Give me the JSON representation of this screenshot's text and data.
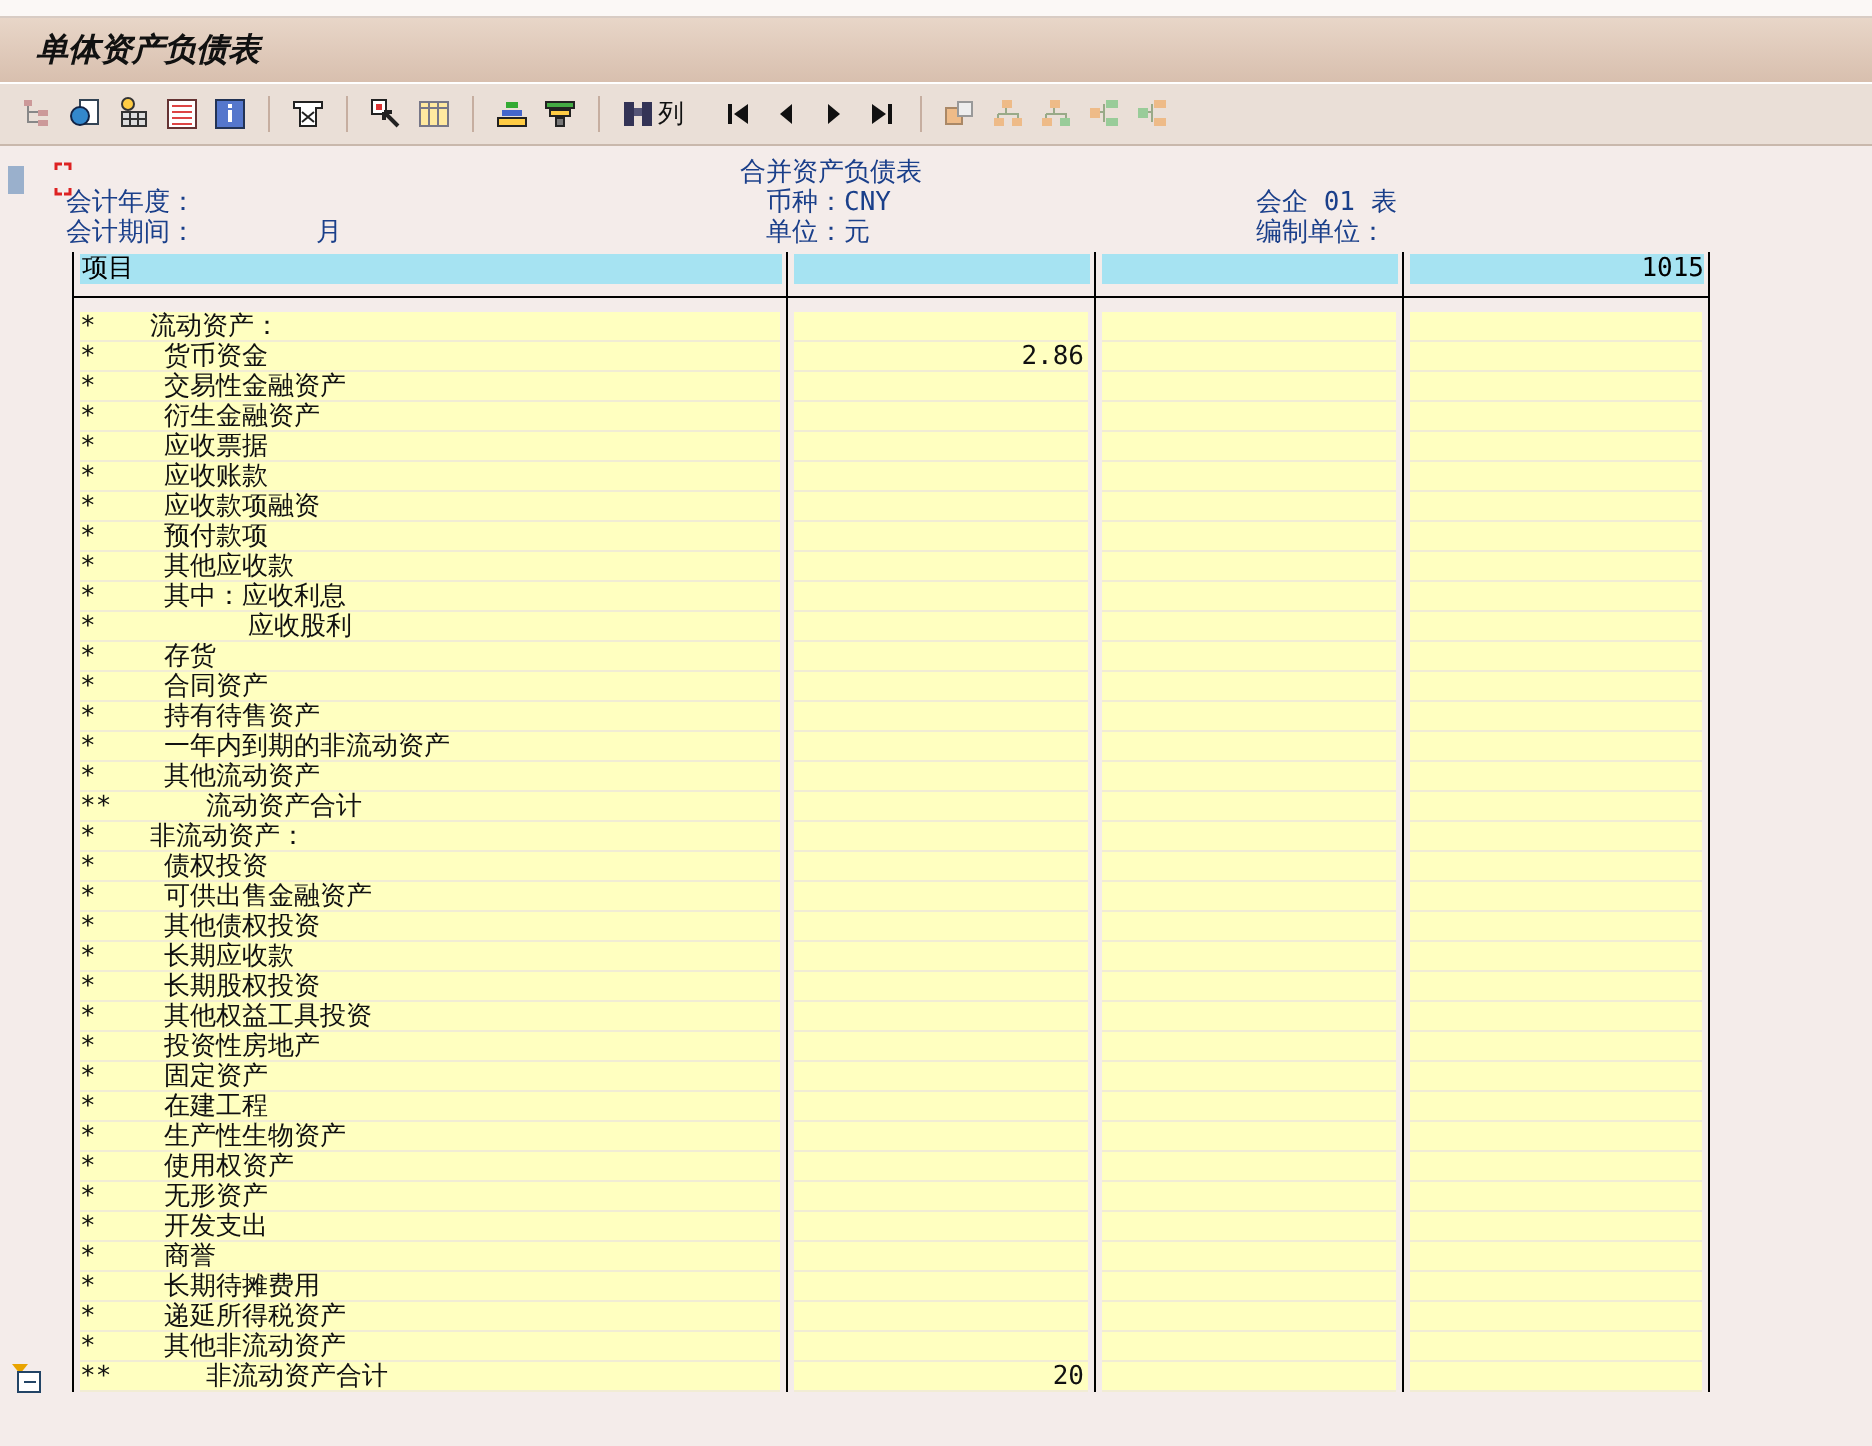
{
  "window": {
    "title": "单体资产负债表"
  },
  "toolbar": {
    "find_label": "列"
  },
  "report": {
    "title": "合并资产负债表",
    "currency": "币种：CNY",
    "unit": "单位：元",
    "form_no": "会企 01 表",
    "company_label": "编制单位：",
    "year_label": "会计年度：",
    "period_label": "会计期间：",
    "period_month": "月"
  },
  "table": {
    "columns": [
      "项目",
      "",
      "",
      "1015"
    ],
    "rows": [
      {
        "marker": "*",
        "label": "流动资产：",
        "kind": "heading"
      },
      {
        "marker": "*",
        "label": "货币资金",
        "kind": "item",
        "value": "2.86"
      },
      {
        "marker": "*",
        "label": "交易性金融资产",
        "kind": "item"
      },
      {
        "marker": "*",
        "label": "衍生金融资产",
        "kind": "item"
      },
      {
        "marker": "*",
        "label": "应收票据",
        "kind": "item"
      },
      {
        "marker": "*",
        "label": "应收账款",
        "kind": "item"
      },
      {
        "marker": "*",
        "label": "应收款项融资",
        "kind": "item"
      },
      {
        "marker": "*",
        "label": "预付款项",
        "kind": "item"
      },
      {
        "marker": "*",
        "label": "其他应收款",
        "kind": "item"
      },
      {
        "marker": "*",
        "label": "其中：应收利息",
        "kind": "item"
      },
      {
        "marker": "*",
        "label": "应收股利",
        "kind": "sub"
      },
      {
        "marker": "*",
        "label": "存货",
        "kind": "item"
      },
      {
        "marker": "*",
        "label": "合同资产",
        "kind": "item"
      },
      {
        "marker": "*",
        "label": "持有待售资产",
        "kind": "item"
      },
      {
        "marker": "*",
        "label": "一年内到期的非流动资产",
        "kind": "item"
      },
      {
        "marker": "*",
        "label": "其他流动资产",
        "kind": "item"
      },
      {
        "marker": "**",
        "label": "流动资产合计",
        "kind": "subtotal"
      },
      {
        "marker": "*",
        "label": "非流动资产：",
        "kind": "heading"
      },
      {
        "marker": "*",
        "label": "债权投资",
        "kind": "item"
      },
      {
        "marker": "*",
        "label": "可供出售金融资产",
        "kind": "item"
      },
      {
        "marker": "*",
        "label": "其他债权投资",
        "kind": "item"
      },
      {
        "marker": "*",
        "label": "长期应收款",
        "kind": "item"
      },
      {
        "marker": "*",
        "label": "长期股权投资",
        "kind": "item"
      },
      {
        "marker": "*",
        "label": "其他权益工具投资",
        "kind": "item"
      },
      {
        "marker": "*",
        "label": "投资性房地产",
        "kind": "item"
      },
      {
        "marker": "*",
        "label": "固定资产",
        "kind": "item"
      },
      {
        "marker": "*",
        "label": "在建工程",
        "kind": "item"
      },
      {
        "marker": "*",
        "label": "生产性生物资产",
        "kind": "item"
      },
      {
        "marker": "*",
        "label": "使用权资产",
        "kind": "item"
      },
      {
        "marker": "*",
        "label": "无形资产",
        "kind": "item"
      },
      {
        "marker": "*",
        "label": "开发支出",
        "kind": "item"
      },
      {
        "marker": "*",
        "label": "商誉",
        "kind": "item"
      },
      {
        "marker": "*",
        "label": "长期待摊费用",
        "kind": "item"
      },
      {
        "marker": "*",
        "label": "递延所得税资产",
        "kind": "item"
      },
      {
        "marker": "*",
        "label": "其他非流动资产",
        "kind": "item"
      },
      {
        "marker": "**",
        "label": "非流动资产合计",
        "kind": "subtotal",
        "value": "20"
      }
    ]
  }
}
